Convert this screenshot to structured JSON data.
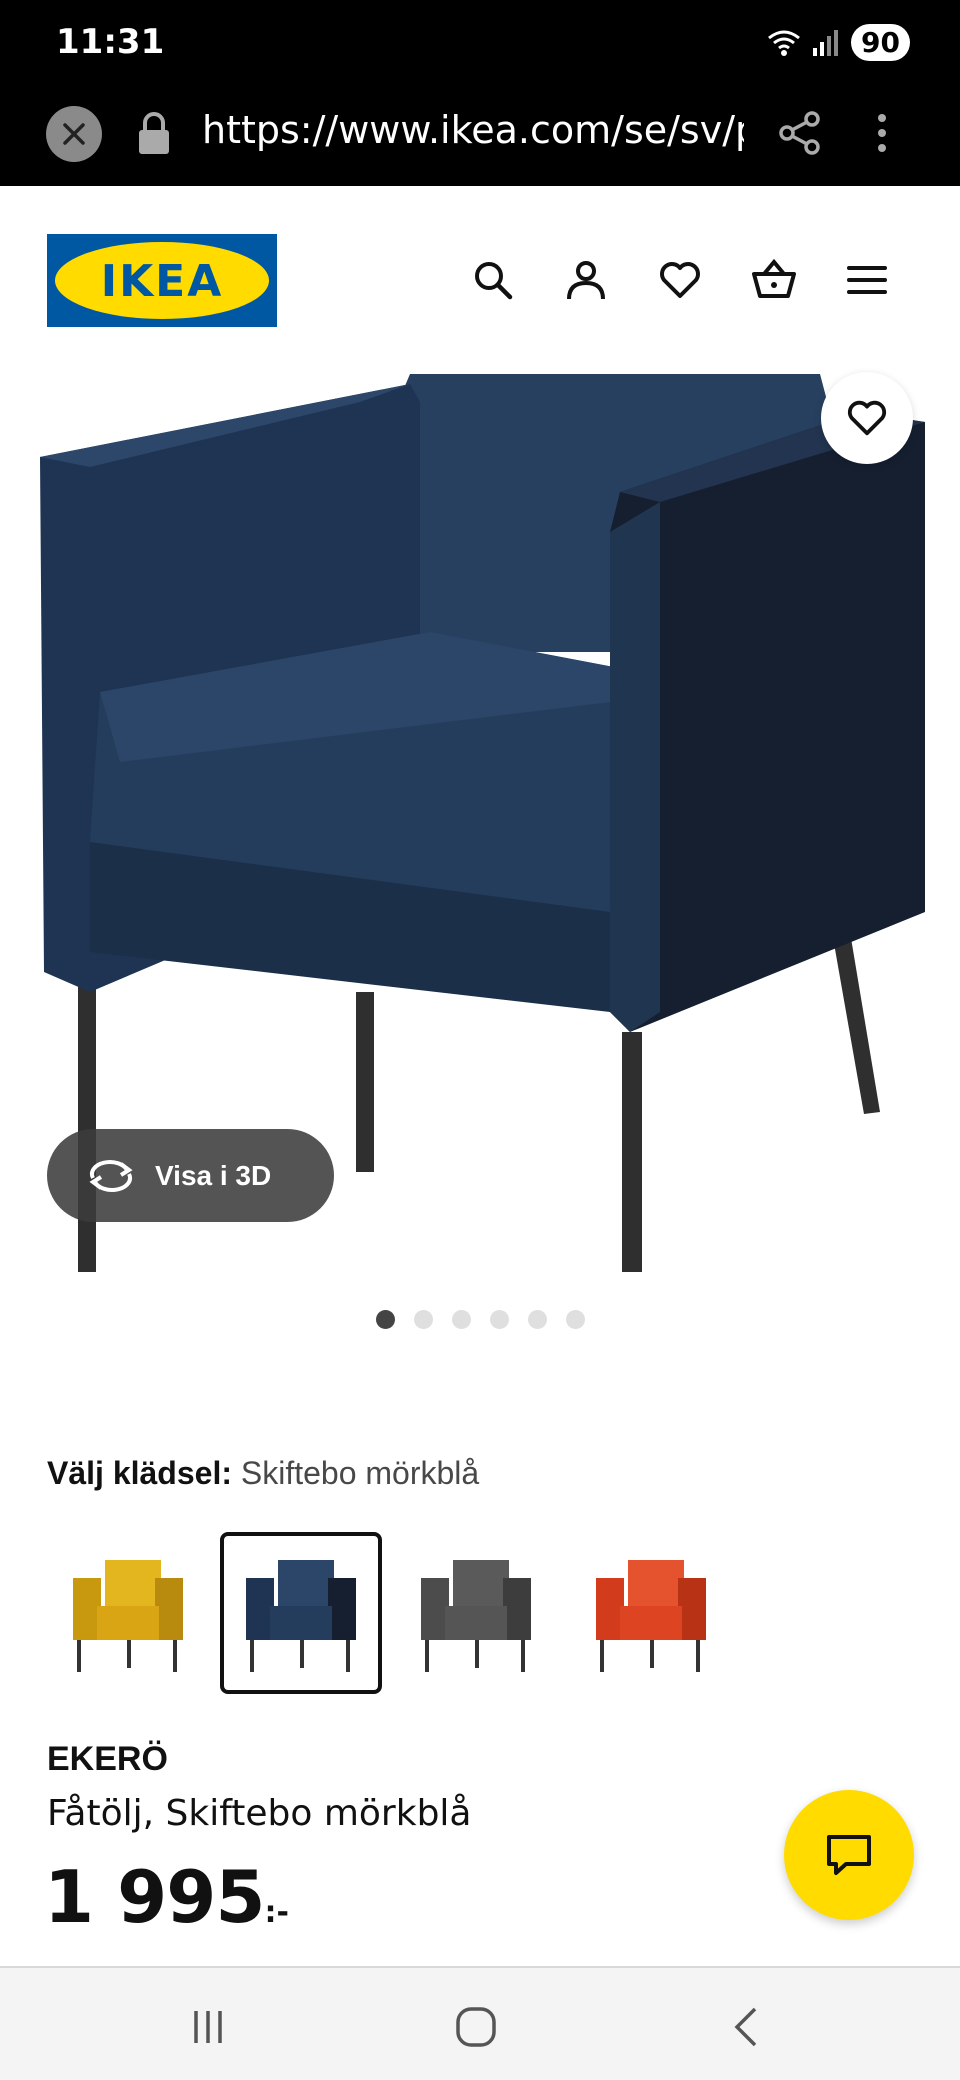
{
  "status_bar": {
    "time": "11:31",
    "battery": "90"
  },
  "browser": {
    "url": "https://www.ikea.com/se/sv/p/ekero"
  },
  "header": {
    "logo_text": "IKEA"
  },
  "gallery": {
    "view_3d_label": "Visa i 3D",
    "image_count": 6,
    "active_index": 0
  },
  "upholstery": {
    "label": "Välj klädsel:",
    "value": "Skiftebo mörkblå",
    "swatches": [
      {
        "name": "yellow",
        "color": "#d9a515",
        "selected": false
      },
      {
        "name": "dark-blue",
        "color": "#1f3550",
        "selected": true
      },
      {
        "name": "dark-gray",
        "color": "#4c4c4c",
        "selected": false
      },
      {
        "name": "red",
        "color": "#d23c1c",
        "selected": false
      }
    ]
  },
  "product": {
    "name": "EKERÖ",
    "description": "Fåtölj, Skiftebo mörkblå",
    "price": "1 995",
    "price_suffix": ":-"
  },
  "colors": {
    "ikea_blue": "#0058a3",
    "ikea_yellow": "#ffdb00",
    "chair_blue": "#1f3550"
  }
}
